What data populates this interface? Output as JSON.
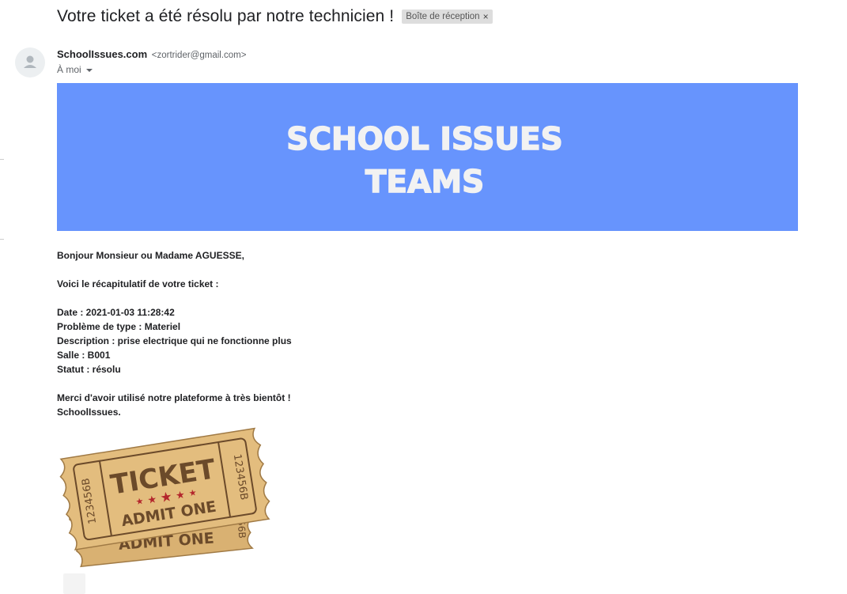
{
  "email": {
    "subject": "Votre ticket a été résolu par notre technicien !",
    "label": "Boîte de réception",
    "label_close": "×",
    "sender_name": "SchoolIssues.com",
    "sender_email": "<zortrider@gmail.com>",
    "recipient": "À moi"
  },
  "banner": {
    "line1": "SCHOOL ISSUES",
    "line2": "TEAMS",
    "background": "#6794fd",
    "text_color": "#f2f2f2"
  },
  "message": {
    "greeting": "Bonjour Monsieur ou Madame AGUESSE,",
    "intro": "Voici le récapitulatif de votre ticket :",
    "date": "Date : 2021-01-03 11:28:42",
    "type": "Problème de type : Materiel",
    "description": "Description : prise electrique qui ne fonctionne plus",
    "room": "Salle : B001",
    "status": "Statut : résolu",
    "thanks": "Merci d'avoir utilisé notre plateforme à très bientôt !",
    "signature": "SchoolIssues."
  },
  "ticket_image": {
    "title": "TICKET",
    "subtitle": "ADMIT ONE",
    "serial": "123456B",
    "back_subtitle": "ADMIT ONE",
    "back_serial": "56B",
    "paper_color": "#e3bd7e",
    "ink_color": "#6b4a2a",
    "star_color": "#b3262c"
  },
  "icons": {
    "avatar": "person-icon",
    "recipient_toggle": "caret-down-icon"
  }
}
